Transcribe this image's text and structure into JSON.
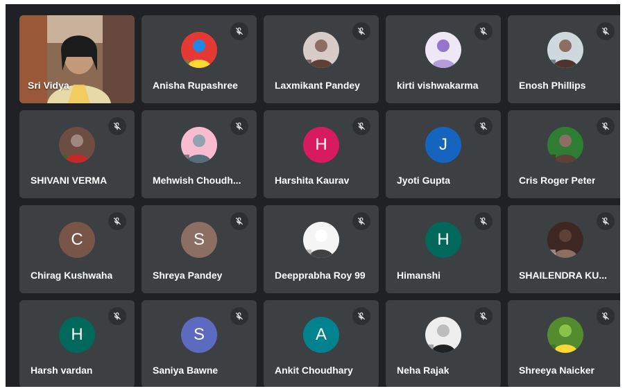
{
  "participants": [
    {
      "name": "Sri Vidya",
      "kind": "video"
    },
    {
      "name": "Anisha Rupashree",
      "kind": "photo",
      "photo": "colorful-portrait"
    },
    {
      "name": "Laxmikant Pandey",
      "kind": "photo",
      "photo": "man-portrait"
    },
    {
      "name": "kirti vishwakarma",
      "kind": "photo",
      "photo": "light-portrait"
    },
    {
      "name": "Enosh Phillips",
      "kind": "photo",
      "photo": "man-portrait-2"
    },
    {
      "name": "SHIVANI VERMA",
      "kind": "photo",
      "photo": "outdoor-portrait"
    },
    {
      "name": "Mehwish Choudh...",
      "kind": "photo",
      "photo": "landscape-portrait"
    },
    {
      "name": "Harshita Kaurav",
      "kind": "initial",
      "initial": "H",
      "color": "#d81b60"
    },
    {
      "name": "Jyoti Gupta",
      "kind": "initial",
      "initial": "J",
      "color": "#1565c0"
    },
    {
      "name": "Cris Roger Peter",
      "kind": "photo",
      "photo": "bear-portrait"
    },
    {
      "name": "Chirag Kushwaha",
      "kind": "initial",
      "initial": "C",
      "color": "#795548"
    },
    {
      "name": "Shreya Pandey",
      "kind": "initial",
      "initial": "S",
      "color": "#8d6e63"
    },
    {
      "name": "Deepprabha Roy 99",
      "kind": "photo",
      "photo": "sketch-portrait"
    },
    {
      "name": "Himanshi",
      "kind": "initial",
      "initial": "H",
      "color": "#00695c"
    },
    {
      "name": "SHAILENDRA KU...",
      "kind": "photo",
      "photo": "dark-portrait"
    },
    {
      "name": "Harsh vardan",
      "kind": "initial",
      "initial": "H",
      "color": "#00695c"
    },
    {
      "name": "Saniya Bawne",
      "kind": "initial",
      "initial": "S",
      "color": "#5c6bc0"
    },
    {
      "name": "Ankit Choudhary",
      "kind": "initial",
      "initial": "A",
      "color": "#00838f"
    },
    {
      "name": "Neha Rajak",
      "kind": "photo",
      "photo": "bw-portrait"
    },
    {
      "name": "Shreeya Naicker",
      "kind": "photo",
      "photo": "cartoon-portrait"
    }
  ],
  "icons": {
    "mute": "mic-off-icon"
  },
  "colors": {
    "background": "#202124",
    "tile": "#3c4043",
    "text": "#ffffff"
  }
}
